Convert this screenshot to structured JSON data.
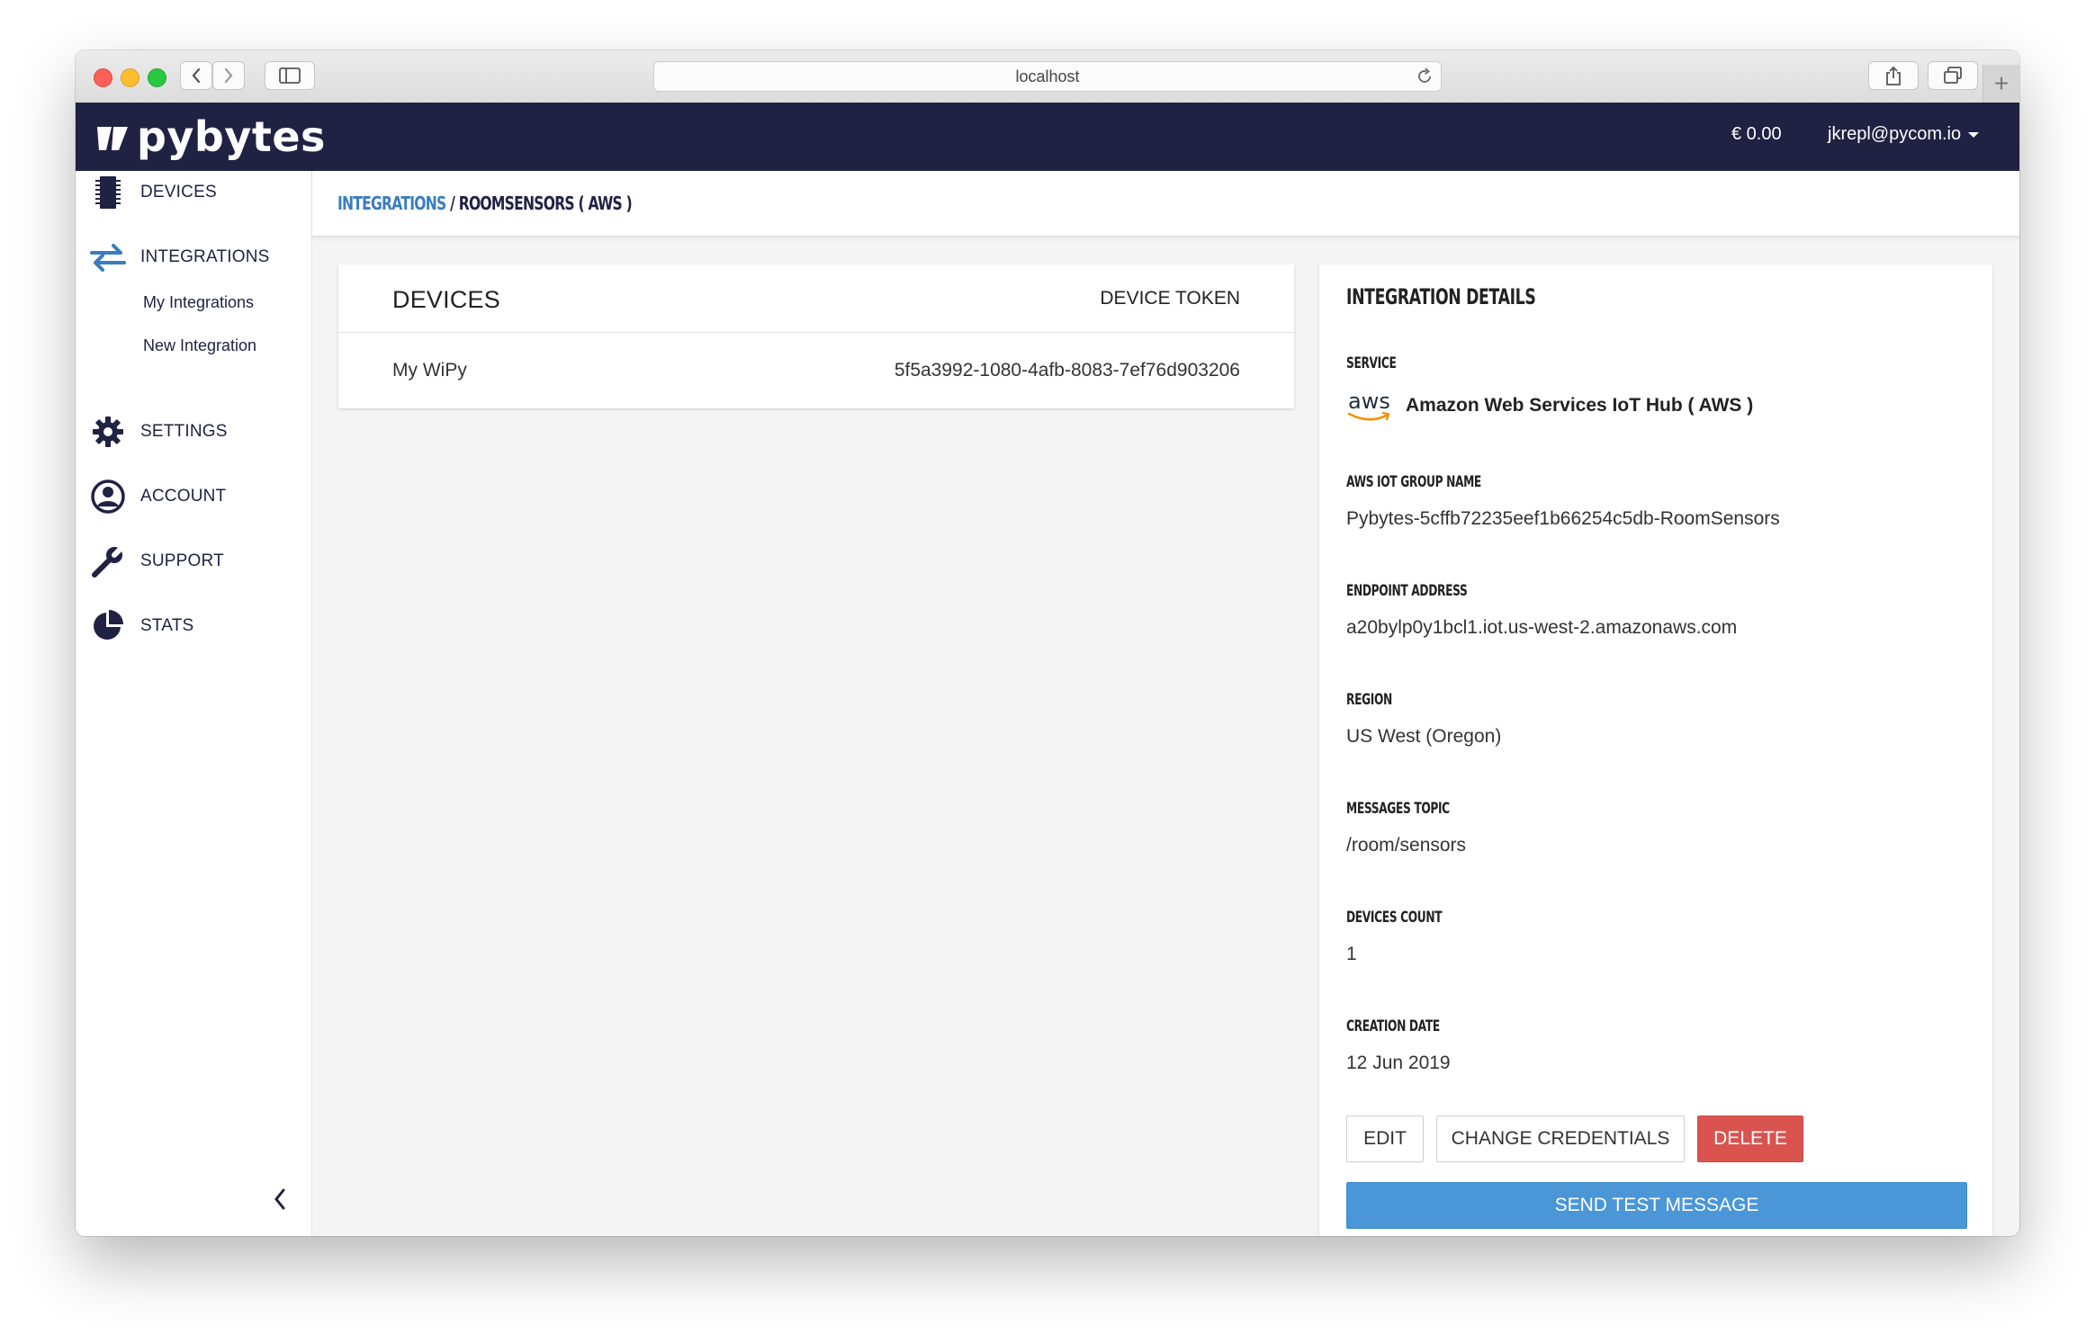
{
  "browser": {
    "url": "localhost"
  },
  "header": {
    "logo_text": "pybytes",
    "balance": "€ 0.00",
    "user_email": "jkrepl@pycom.io"
  },
  "sidebar": {
    "items": [
      {
        "label": "DEVICES",
        "icon": "chip-icon"
      },
      {
        "label": "INTEGRATIONS",
        "icon": "arrows-exchange-icon"
      },
      {
        "label": "SETTINGS",
        "icon": "gear-icon"
      },
      {
        "label": "ACCOUNT",
        "icon": "user-circle-icon"
      },
      {
        "label": "SUPPORT",
        "icon": "wrench-icon"
      },
      {
        "label": "STATS",
        "icon": "pie-chart-icon"
      }
    ],
    "sub_items": [
      {
        "label": "My Integrations"
      },
      {
        "label": "New Integration"
      }
    ]
  },
  "breadcrumb": {
    "link": "INTEGRATIONS",
    "separator": " / ",
    "current": "ROOMSENSORS ( AWS )"
  },
  "devices_card": {
    "title": "DEVICES",
    "column_token": "DEVICE TOKEN",
    "rows": [
      {
        "name": "My WiPy",
        "token": "5f5a3992-1080-4afb-8083-7ef76d903206"
      }
    ]
  },
  "details": {
    "title": "INTEGRATION DETAILS",
    "service_label": "SERVICE",
    "service_logo": "aws",
    "service_name": "Amazon Web Services IoT Hub ( AWS )",
    "fields": [
      {
        "label": "AWS IOT GROUP NAME",
        "value": "Pybytes-5cffb72235eef1b66254c5db-RoomSensors"
      },
      {
        "label": "ENDPOINT ADDRESS",
        "value": "a20bylp0y1bcl1.iot.us-west-2.amazonaws.com"
      },
      {
        "label": "REGION",
        "value": "US West (Oregon)"
      },
      {
        "label": "MESSAGES TOPIC",
        "value": "/room/sensors"
      },
      {
        "label": "DEVICES COUNT",
        "value": "1"
      },
      {
        "label": "CREATION DATE",
        "value": "12 Jun 2019"
      }
    ],
    "buttons": {
      "edit": "EDIT",
      "change_credentials": "CHANGE CREDENTIALS",
      "delete": "DELETE",
      "send_test": "SEND TEST MESSAGE"
    }
  },
  "colors": {
    "navy": "#1f2242",
    "link_blue": "#3a7cc0",
    "primary": "#4a96d6",
    "danger": "#d9534f",
    "aws_orange": "#f29100"
  }
}
